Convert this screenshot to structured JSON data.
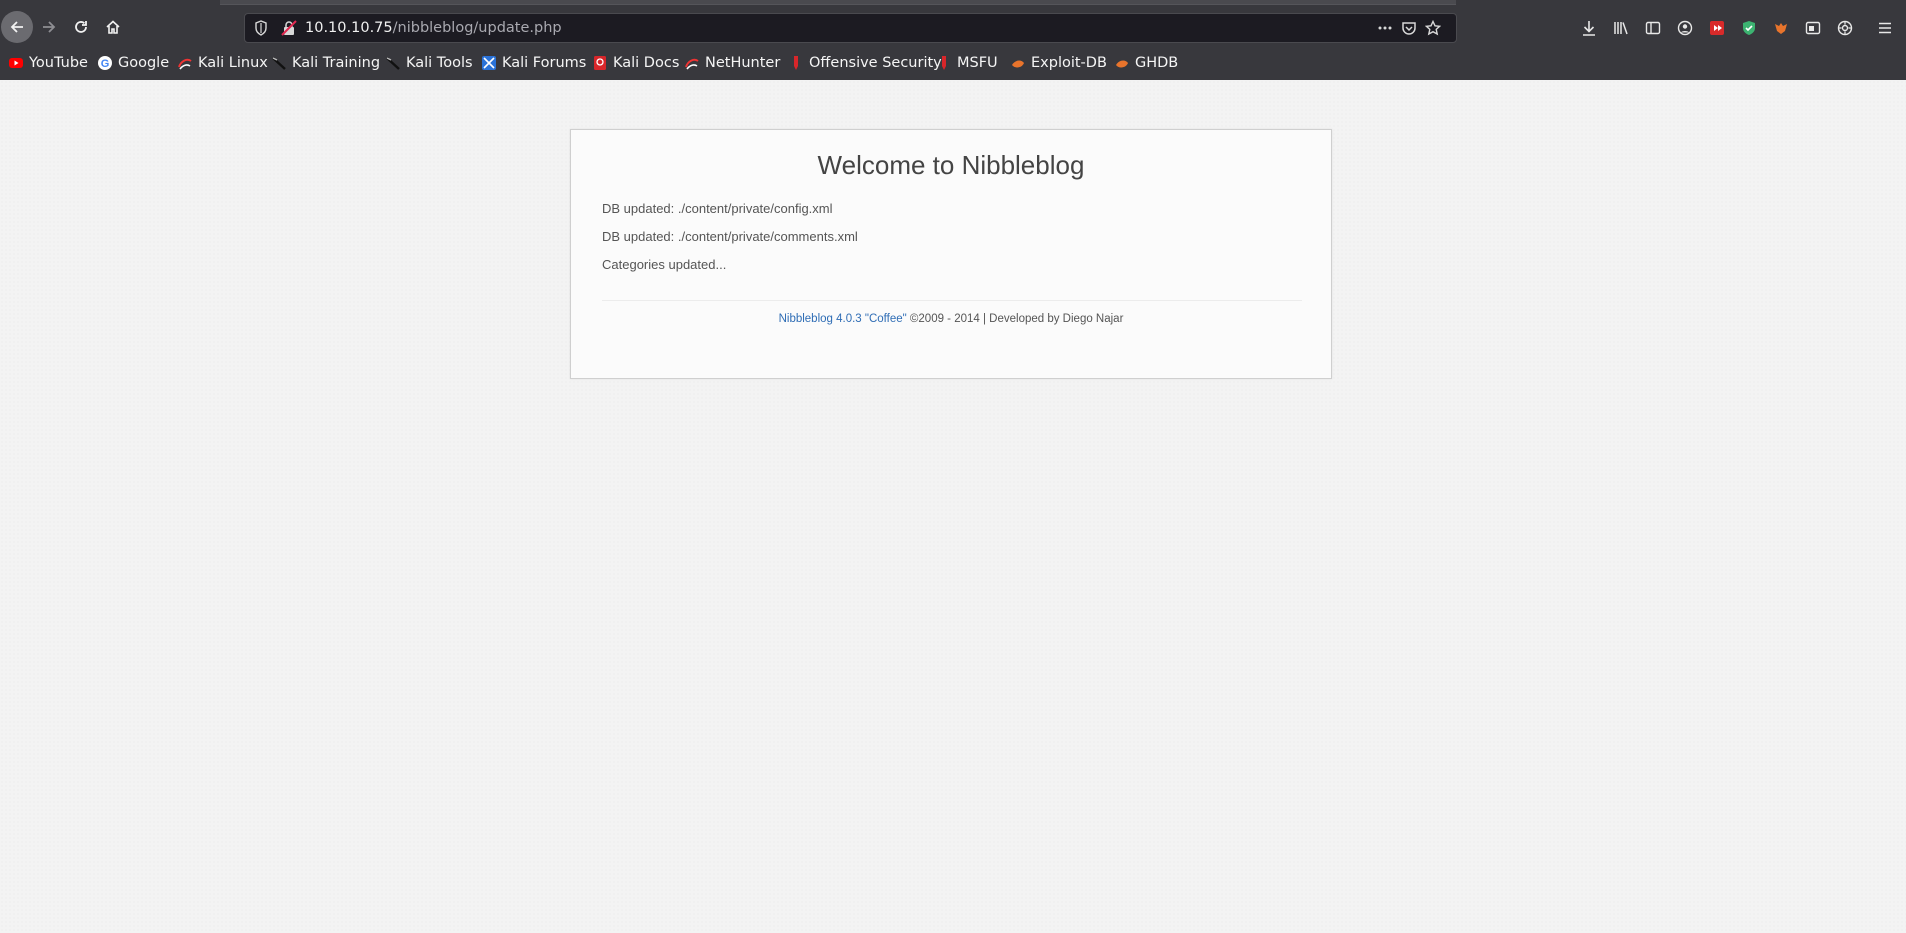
{
  "browser": {
    "url_host": "10.10.10.75",
    "url_path": "/nibbleblog/update.php"
  },
  "bookmarks": [
    {
      "label": "YouTube",
      "icon": "youtube-icon"
    },
    {
      "label": "Google",
      "icon": "google-icon"
    },
    {
      "label": "Kali Linux",
      "icon": "kali-linux-icon"
    },
    {
      "label": "Kali Training",
      "icon": "kali-training-icon"
    },
    {
      "label": "Kali Tools",
      "icon": "kali-tools-icon"
    },
    {
      "label": "Kali Forums",
      "icon": "kali-forums-icon"
    },
    {
      "label": "Kali Docs",
      "icon": "kali-docs-icon"
    },
    {
      "label": "NetHunter",
      "icon": "nethunter-icon"
    },
    {
      "label": "Offensive Security",
      "icon": "offsec-icon"
    },
    {
      "label": "MSFU",
      "icon": "msfu-icon"
    },
    {
      "label": "Exploit-DB",
      "icon": "exploit-db-icon"
    },
    {
      "label": "GHDB",
      "icon": "ghdb-icon"
    }
  ],
  "page": {
    "title": "Welcome to Nibbleblog",
    "messages": [
      "DB updated: ./content/private/config.xml",
      "DB updated: ./content/private/comments.xml",
      "Categories updated..."
    ],
    "footer_link": "Nibbleblog 4.0.3 \"Coffee\"",
    "footer_text": " ©2009 - 2014 | Developed by Diego Najar"
  },
  "colors": {
    "chrome_bg": "#38383d",
    "urlbar_bg": "#1c1b22",
    "link": "#2f6db5"
  }
}
